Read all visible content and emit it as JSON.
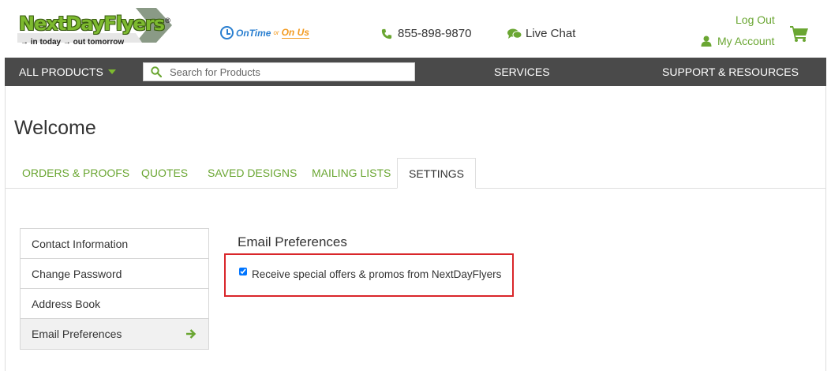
{
  "header": {
    "logo": {
      "name": "NextDayFlyers",
      "part1": "NextDay",
      "part2": "Flyers",
      "reg": "®",
      "tagline": "→ in today → out tomorrow"
    },
    "ontime": {
      "part1": "OnTime",
      "part2": "or",
      "part3": "On Us"
    },
    "phone": "855-898-9870",
    "live_chat": "Live Chat",
    "logout": "Log Out",
    "my_account": "My Account"
  },
  "nav": {
    "all_products": "ALL PRODUCTS",
    "search_placeholder": "Search for Products",
    "services": "SERVICES",
    "support": "SUPPORT & RESOURCES"
  },
  "page": {
    "title": "Welcome",
    "tabs": [
      {
        "label": "ORDERS & PROOFS",
        "active": false
      },
      {
        "label": "QUOTES",
        "active": false
      },
      {
        "label": "SAVED DESIGNS",
        "active": false
      },
      {
        "label": "MAILING LISTS",
        "active": false
      },
      {
        "label": "SETTINGS",
        "active": true
      }
    ]
  },
  "sidebar": {
    "items": [
      {
        "label": "Contact Information",
        "active": false
      },
      {
        "label": "Change Password",
        "active": false
      },
      {
        "label": "Address Book",
        "active": false
      },
      {
        "label": "Email Preferences",
        "active": true
      }
    ]
  },
  "preferences": {
    "title": "Email Preferences",
    "offers_label": "Receive special offers & promos from NextDayFlyers",
    "offers_checked": true
  },
  "colors": {
    "brand_green": "#6aa632",
    "nav_bg": "#4a4a4a",
    "highlight_red": "#d9262a",
    "ontime_blue": "#2a7fd0",
    "ontime_orange": "#f39a1e"
  }
}
